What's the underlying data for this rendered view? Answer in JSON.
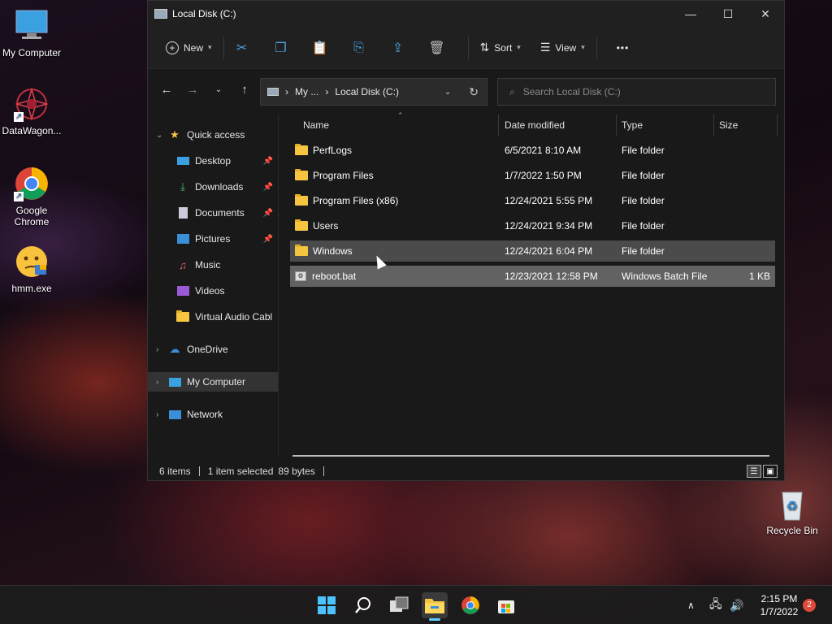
{
  "desktop": {
    "icons": [
      {
        "label": "My Computer"
      },
      {
        "label": "DataWagon..."
      },
      {
        "label": "Google Chrome"
      },
      {
        "label": "hmm.exe"
      },
      {
        "label": "Recycle Bin"
      }
    ]
  },
  "window": {
    "title": "Local Disk (C:)",
    "controls": {
      "minimize": "—",
      "maximize": "☐",
      "close": "✕"
    }
  },
  "toolbar": {
    "new_label": "New",
    "sort_label": "Sort",
    "view_label": "View",
    "more_label": "•••"
  },
  "address": {
    "crumbs": [
      "My ...",
      "Local Disk (C:)"
    ],
    "search_placeholder": "Search Local Disk (C:)"
  },
  "sidebar": {
    "quick_access": "Quick access",
    "items": [
      {
        "label": "Desktop",
        "pinned": true
      },
      {
        "label": "Downloads",
        "pinned": true
      },
      {
        "label": "Documents",
        "pinned": true
      },
      {
        "label": "Pictures",
        "pinned": true
      },
      {
        "label": "Music",
        "pinned": false
      },
      {
        "label": "Videos",
        "pinned": false
      },
      {
        "label": "Virtual Audio Cabl",
        "pinned": false
      }
    ],
    "onedrive": "OneDrive",
    "my_computer": "My Computer",
    "network": "Network"
  },
  "columns": {
    "name": "Name",
    "date": "Date modified",
    "type": "Type",
    "size": "Size"
  },
  "files": [
    {
      "name": "PerfLogs",
      "date": "6/5/2021 8:10 AM",
      "type": "File folder",
      "size": ""
    },
    {
      "name": "Program Files",
      "date": "1/7/2022 1:50 PM",
      "type": "File folder",
      "size": ""
    },
    {
      "name": "Program Files (x86)",
      "date": "12/24/2021 5:55 PM",
      "type": "File folder",
      "size": ""
    },
    {
      "name": "Users",
      "date": "12/24/2021 9:34 PM",
      "type": "File folder",
      "size": ""
    },
    {
      "name": "Windows",
      "date": "12/24/2021 6:04 PM",
      "type": "File folder",
      "size": ""
    },
    {
      "name": "reboot.bat",
      "date": "12/23/2021 12:58 PM",
      "type": "Windows Batch File",
      "size": "1 KB"
    }
  ],
  "status": {
    "count": "6 items",
    "selected": "1 item selected",
    "bytes": "89 bytes"
  },
  "taskbar": {
    "time": "2:15 PM",
    "date": "1/7/2022",
    "notification_count": "2"
  },
  "colors": {
    "accent": "#60cdff",
    "folder": "#f5c542",
    "selection": "#4b4b4b"
  }
}
